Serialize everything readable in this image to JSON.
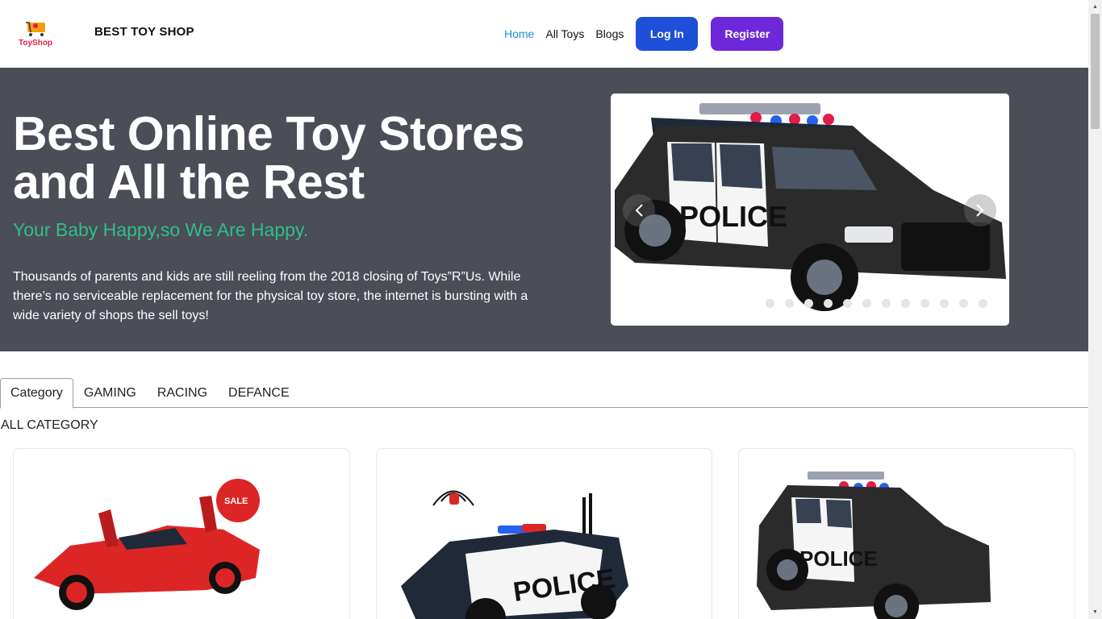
{
  "header": {
    "logo_text": "ToyShop",
    "brand": "BEST TOY SHOP",
    "nav": [
      {
        "label": "Home"
      },
      {
        "label": "All Toys"
      },
      {
        "label": "Blogs"
      }
    ],
    "login_label": "Log In",
    "register_label": "Register"
  },
  "hero": {
    "title": "Best Online Toy Stores and All the Rest",
    "subtitle": "Your Baby Happy,so We Are Happy.",
    "description": "Thousands of parents and kids are still reeling from the 2018 closing of Toys”R”Us. While there’s no serviceable replacement for the physical toy store, the internet is bursting with a wide variety of shops the sell toys!",
    "carousel": {
      "slide_text": "POLICE",
      "dot_count": 12
    }
  },
  "tabs": [
    {
      "label": "Category"
    },
    {
      "label": "GAMING"
    },
    {
      "label": "RACING"
    },
    {
      "label": "DEFANCE"
    }
  ],
  "section_label": "ALL CATEGORY",
  "cards": [
    {
      "badge": "SALE"
    },
    {
      "text": "POLICE"
    },
    {
      "text": "POLICE"
    }
  ],
  "colors": {
    "accent_link": "#1f8fd6",
    "login_btn": "#1d4fd8",
    "register_btn": "#6d28d9",
    "hero_bg": "#4b4d57",
    "subtitle": "#2fbf87"
  }
}
